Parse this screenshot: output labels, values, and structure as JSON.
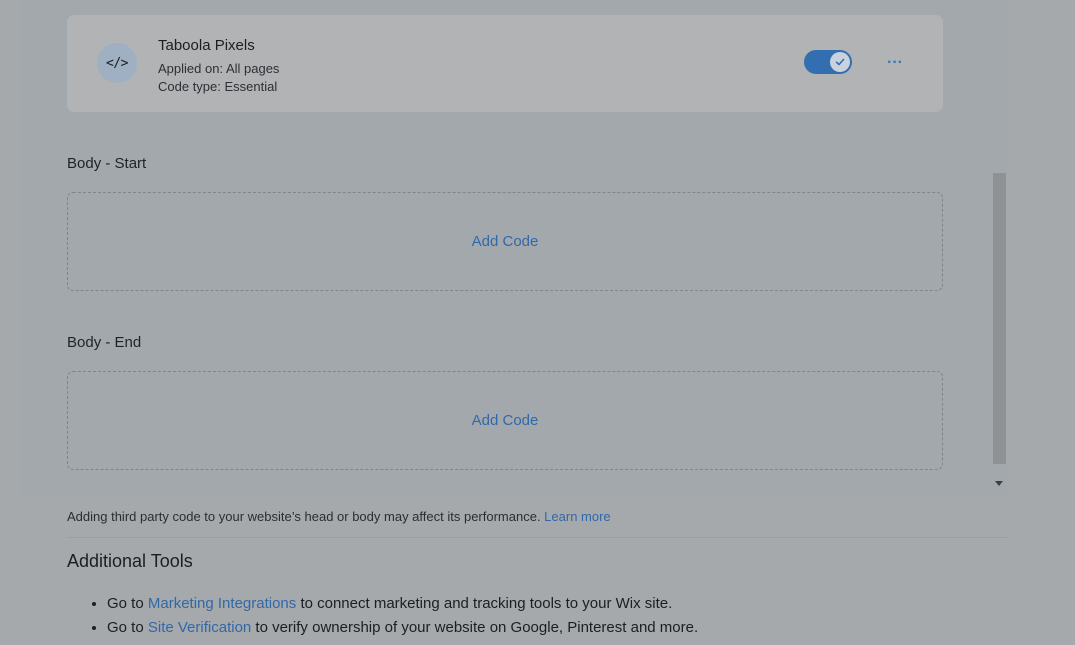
{
  "code_card": {
    "icon": "code-icon",
    "icon_glyph": "</>",
    "name": "Taboola Pixels",
    "applied_on": "Applied on: All pages",
    "code_type": "Code type: Essential",
    "toggle_on": true,
    "more_glyph": "···"
  },
  "sections": [
    {
      "label": "Body - Start",
      "add_label": "Add Code"
    },
    {
      "label": "Body - End",
      "add_label": "Add Code"
    }
  ],
  "notice": {
    "text": "Adding third party code to your website’s head or body may affect its performance. ",
    "link": "Learn more"
  },
  "additional_tools": {
    "heading": "Additional Tools",
    "items": [
      {
        "prefix": "Go to ",
        "link": "Marketing Integrations",
        "suffix": " to connect marketing and tracking tools to your Wix site."
      },
      {
        "prefix": "Go to ",
        "link": "Site Verification",
        "suffix": " to verify ownership of your website on Google, Pinterest and more."
      }
    ]
  },
  "colors": {
    "overlay": "#a5a9ac",
    "accent": "#3268a8",
    "toggle": "#336fb0"
  }
}
